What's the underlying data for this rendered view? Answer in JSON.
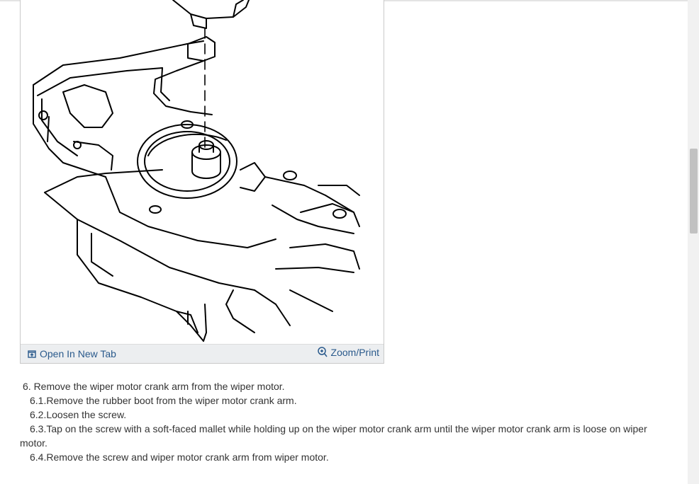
{
  "figure": {
    "open_new_tab": "Open In New Tab",
    "zoom_print": "Zoom/Print"
  },
  "steps": {
    "step6": "6. Remove the wiper motor crank arm from the wiper motor.",
    "step6_1": "6.1.Remove the rubber boot from the wiper motor crank arm.",
    "step6_2": "6.2.Loosen the screw.",
    "step6_3": "6.3.Tap on the screw with a soft-faced mallet while holding up on the wiper motor crank arm until the wiper motor crank arm is loose on wiper motor.",
    "step6_4": "6.4.Remove the screw and wiper motor crank arm from wiper motor."
  },
  "colors": {
    "link": "#2a5a8c",
    "caption_bar": "#eceef0",
    "text": "#333333"
  },
  "icons": {
    "open_tab": "open-new-tab-icon",
    "zoom": "magnifier-plus-icon"
  }
}
